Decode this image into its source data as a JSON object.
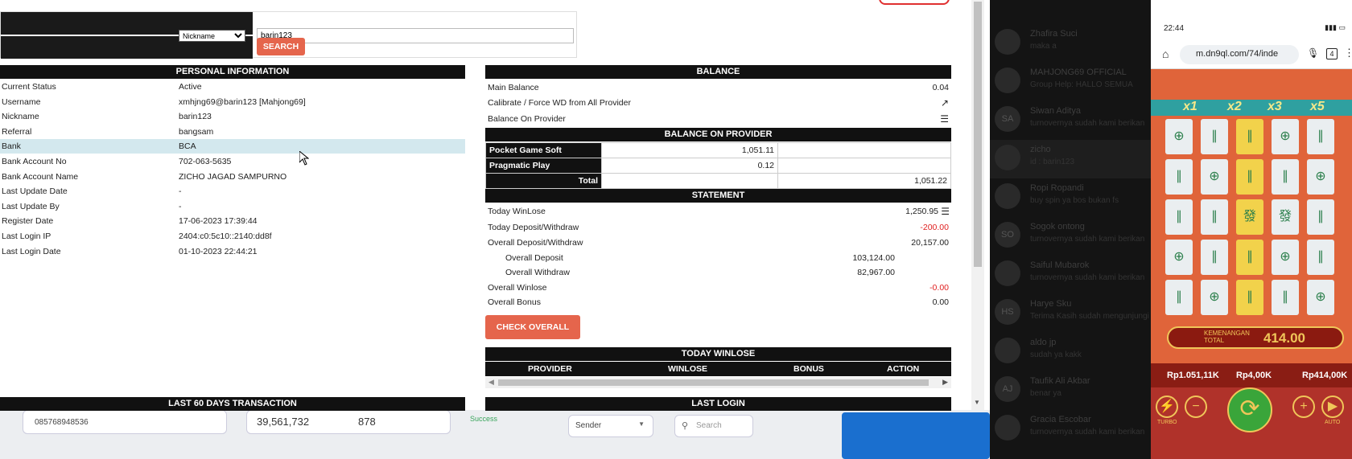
{
  "search": {
    "select_value": "Nickname",
    "query": "barin123",
    "button": "SEARCH"
  },
  "personal": {
    "header": "PERSONAL INFORMATION",
    "rows": [
      {
        "k": "Current Status",
        "v": "Active"
      },
      {
        "k": "Username",
        "v": "xmhjng69@barin123  [Mahjong69]"
      },
      {
        "k": "Nickname",
        "v": "barin123"
      },
      {
        "k": "Referral",
        "v": "bangsam"
      },
      {
        "k": "Bank",
        "v": "BCA"
      },
      {
        "k": "Bank Account No",
        "v": "702-063-5635"
      },
      {
        "k": "Bank Account Name",
        "v": "ZICHO JAGAD SAMPURNO"
      },
      {
        "k": "Last Update Date",
        "v": "-"
      },
      {
        "k": "Last Update By",
        "v": "-"
      },
      {
        "k": "Register Date",
        "v": "17-06-2023 17:39:44"
      },
      {
        "k": "Last Login IP",
        "v": "2404:c0:5c10::2140:dd8f"
      },
      {
        "k": "Last Login Date",
        "v": "01-10-2023 22:44:21"
      }
    ]
  },
  "balance": {
    "header": "BALANCE",
    "main_label": "Main Balance",
    "main_value": "0.04",
    "calibrate_label": "Calibrate / Force WD from All Provider",
    "on_provider_label": "Balance On Provider"
  },
  "provider": {
    "header": "BALANCE ON PROVIDER",
    "rows": [
      {
        "name": "Pocket Game Soft",
        "value": "1,051.11"
      },
      {
        "name": "Pragmatic Play",
        "value": "0.12"
      }
    ],
    "total_label": "Total",
    "total_value": "1,051.22"
  },
  "statement": {
    "header": "STATEMENT",
    "today_winlose_label": "Today WinLose",
    "today_winlose": "1,250.95",
    "today_dw_label": "Today Deposit/Withdraw",
    "today_dw": "-200.00",
    "overall_dw_label": "Overall Deposit/Withdraw",
    "overall_dw": "20,157.00",
    "overall_deposit_label": "Overall Deposit",
    "overall_deposit": "103,124.00",
    "overall_withdraw_label": "Overall Withdraw",
    "overall_withdraw": "82,967.00",
    "overall_winlose_label": "Overall Winlose",
    "overall_winlose": "-0.00",
    "overall_bonus_label": "Overall Bonus",
    "overall_bonus": "0.00",
    "check_button": "CHECK OVERALL"
  },
  "today_winlose": {
    "header": "TODAY WINLOSE",
    "columns": [
      "PROVIDER",
      "WINLOSE",
      "BONUS",
      "ACTION"
    ]
  },
  "footer_headers": {
    "left": "LAST 60 DAYS TRANSACTION",
    "right": "LAST LOGIN"
  },
  "background": {
    "phone_no": "085768948536",
    "amount": "39,561,732",
    "count": "878",
    "status": "Success",
    "sender": "Sender",
    "search_placeholder": "Search"
  },
  "chat": [
    {
      "name": "Zhafira Suci",
      "msg": "maka a",
      "init": ""
    },
    {
      "name": "MAHJONG69 OFFICIAL",
      "msg": "Group Help: HALLO SEMUA",
      "init": ""
    },
    {
      "name": "Siwan Aditya",
      "msg": "turnovernya sudah kami berikan",
      "init": "SA"
    },
    {
      "name": "zicho",
      "msg": "id : barin123",
      "init": ""
    },
    {
      "name": "Ropi Ropandi",
      "msg": "buy spin ya bos bukan fs",
      "init": ""
    },
    {
      "name": "Sogok ontong",
      "msg": "turnovernya sudah kami berikan",
      "init": "SO"
    },
    {
      "name": "Saiful Mubarok",
      "msg": "turnovernya sudah kami berikan",
      "init": ""
    },
    {
      "name": "Harye Sku",
      "msg": "Terima Kasih sudah mengunjungi",
      "init": "HS"
    },
    {
      "name": "aldo jp",
      "msg": "sudah ya kakk",
      "init": ""
    },
    {
      "name": "Taufik Ali Akbar",
      "msg": "benar ya",
      "init": "AJ"
    },
    {
      "name": "Gracia Escobar",
      "msg": "turnovernya sudah kami berikan",
      "init": ""
    }
  ],
  "phone": {
    "time": "22:44",
    "url": "m.dn9ql.com/74/inde",
    "tabs_count": "4",
    "multipliers": [
      "x1",
      "x2",
      "x3",
      "x5"
    ],
    "win_label": "KEMENANGAN TOTAL",
    "win_value": "414.00",
    "balance": "Rp1.051,11K",
    "bet": "Rp4,00K",
    "win": "Rp414,00K",
    "turbo": "TURBO",
    "auto": "AUTO"
  }
}
